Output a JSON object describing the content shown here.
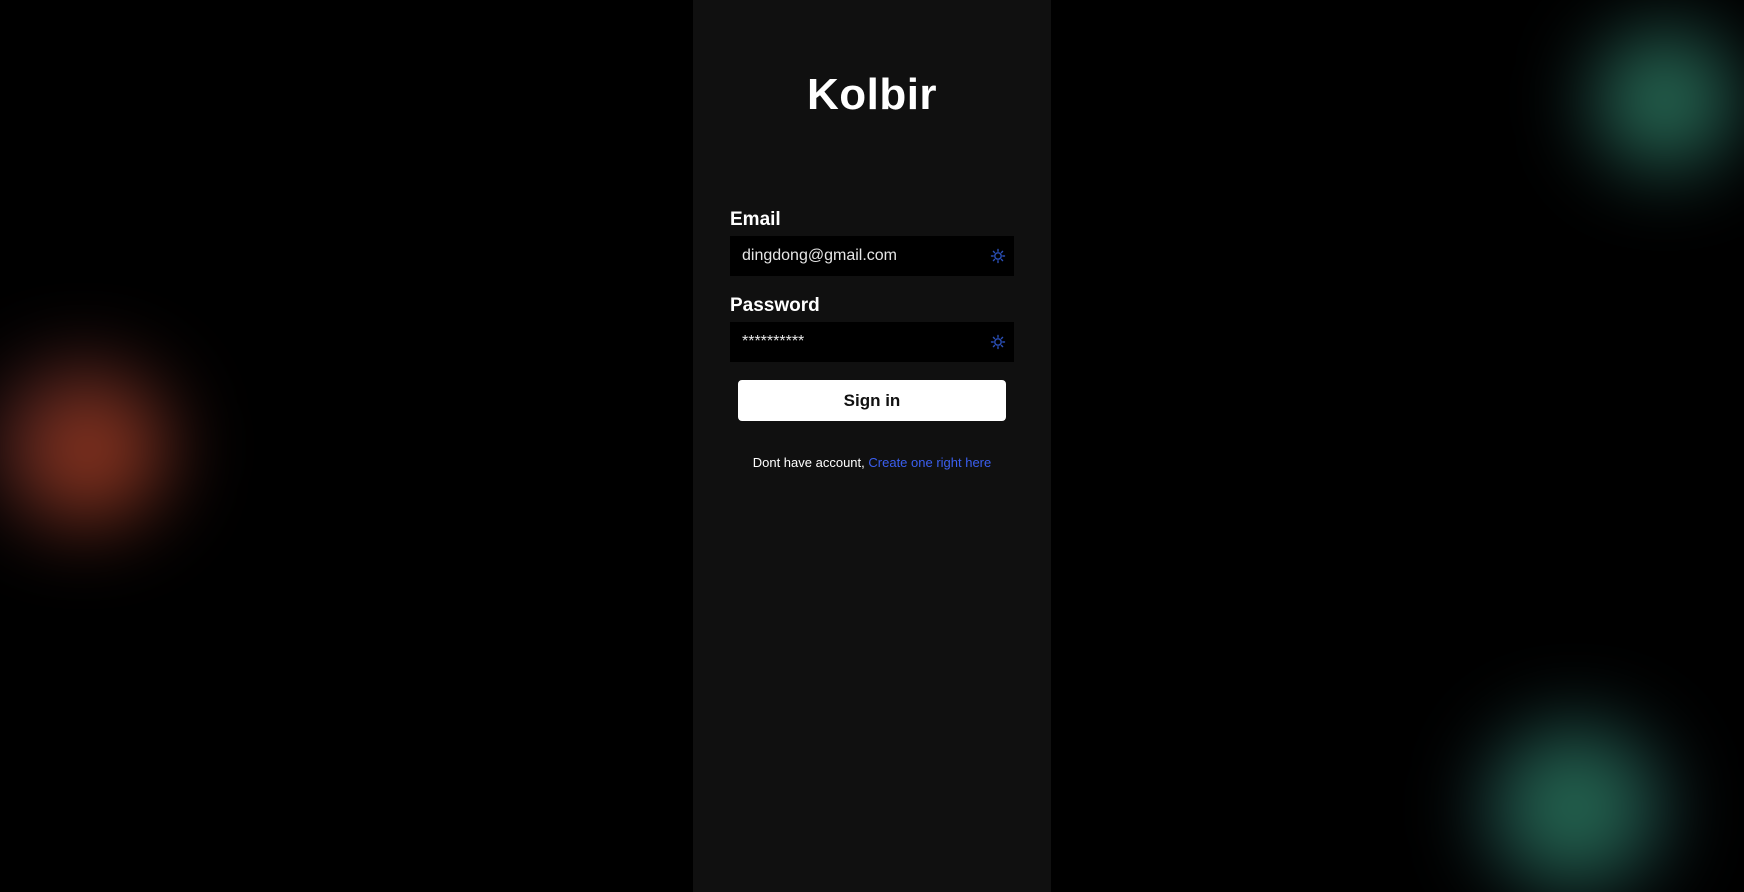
{
  "app": {
    "brand": "Kolbir"
  },
  "form": {
    "email_label": "Email",
    "email_value": "dingdong@gmail.com",
    "password_label": "Password",
    "password_value": "**********",
    "submit_label": "Sign in"
  },
  "footer": {
    "prompt_text": "Dont have account,",
    "signup_link": "Create one right here"
  },
  "icons": {
    "field_autofill": "autofill-key-icon"
  },
  "colors": {
    "page_background": "#000000",
    "panel_background": "#101010",
    "field_background": "#000000",
    "button_background": "#ffffff",
    "link": "#3b5ff0",
    "icon": "#2a4fb8"
  }
}
